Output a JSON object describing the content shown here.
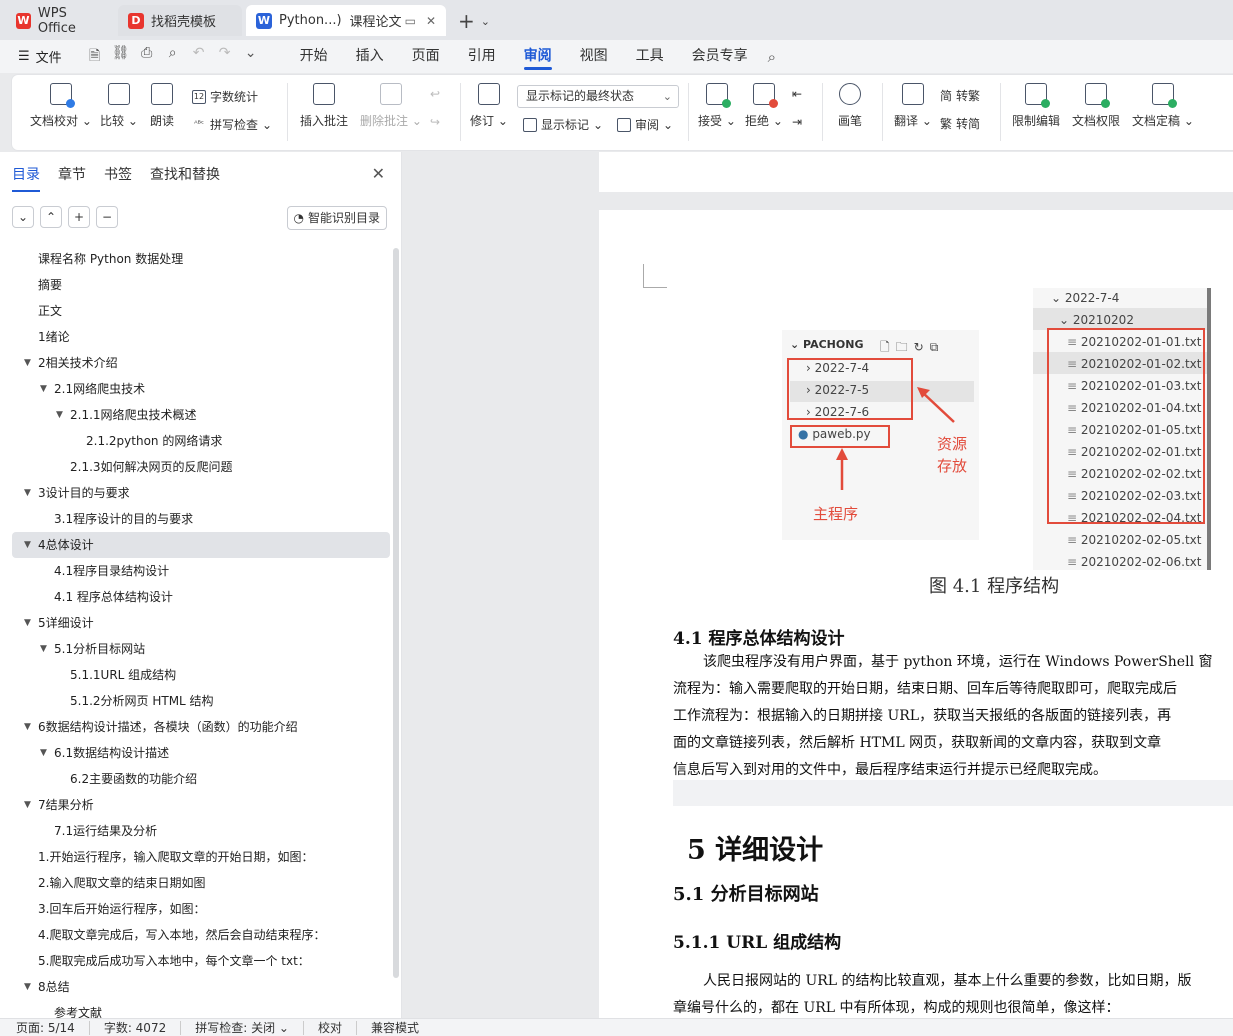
{
  "tabs": {
    "wps": "WPS Office",
    "template": "找稻壳模板",
    "doc": "Python...)",
    "doc_sub": "课程论文"
  },
  "menu": {
    "file": "文件",
    "items": [
      "开始",
      "插入",
      "页面",
      "引用",
      "审阅",
      "视图",
      "工具",
      "会员专享"
    ],
    "active": "审阅"
  },
  "ribbon": {
    "doc_check": "文档校对",
    "compare": "比较",
    "read_aloud": "朗读",
    "word_count": "字数统计",
    "spell_check": "拼写检查",
    "insert_comment": "插入批注",
    "delete_comment": "删除批注",
    "revise": "修订",
    "markup_state": "显示标记的最终状态",
    "show_markup": "显示标记",
    "review": "审阅",
    "accept": "接受",
    "reject": "拒绝",
    "pen": "画笔",
    "translate": "翻译",
    "to_traditional": "转繁",
    "to_simplified": "转简",
    "restrict_edit": "限制编辑",
    "doc_permission": "文档权限",
    "finalize": "文档定稿"
  },
  "nav": {
    "tabs": [
      "目录",
      "章节",
      "书签",
      "查找和替换"
    ],
    "smart_toc": "智能识别目录",
    "toc": [
      {
        "text": "课程名称   Python 数据处理",
        "level": 0,
        "caret": ""
      },
      {
        "text": "摘要",
        "level": 0,
        "caret": ""
      },
      {
        "text": "正文",
        "level": 0,
        "caret": ""
      },
      {
        "text": "1绪论",
        "level": 0,
        "caret": ""
      },
      {
        "text": "2相关技术介绍",
        "level": 0,
        "caret": "down"
      },
      {
        "text": "2.1网络爬虫技术",
        "level": 1,
        "caret": "down"
      },
      {
        "text": "2.1.1网络爬虫技术概述",
        "level": 2,
        "caret": "down"
      },
      {
        "text": "2.1.2python 的网络请求",
        "level": 3,
        "caret": ""
      },
      {
        "text": "2.1.3如何解决网页的反爬问题",
        "level": 2,
        "caret": ""
      },
      {
        "text": "3设计目的与要求",
        "level": 0,
        "caret": "down"
      },
      {
        "text": "3.1程序设计的目的与要求",
        "level": 1,
        "caret": ""
      },
      {
        "text": "4总体设计",
        "level": 0,
        "caret": "down",
        "selected": true
      },
      {
        "text": "4.1程序目录结构设计",
        "level": 1,
        "caret": ""
      },
      {
        "text": "4.1 程序总体结构设计",
        "level": 1,
        "caret": ""
      },
      {
        "text": "5详细设计",
        "level": 0,
        "caret": "down"
      },
      {
        "text": "5.1分析目标网站",
        "level": 1,
        "caret": "down"
      },
      {
        "text": "5.1.1URL 组成结构",
        "level": 2,
        "caret": ""
      },
      {
        "text": "5.1.2分析网页 HTML 结构",
        "level": 2,
        "caret": ""
      },
      {
        "text": "6数据结构设计描述，各模块（函数）的功能介绍",
        "level": 0,
        "caret": "down"
      },
      {
        "text": "6.1数据结构设计描述",
        "level": 1,
        "caret": "down"
      },
      {
        "text": "6.2主要函数的功能介绍",
        "level": 2,
        "caret": ""
      },
      {
        "text": "7结果分析",
        "level": 0,
        "caret": "down"
      },
      {
        "text": "7.1运行结果及分析",
        "level": 1,
        "caret": ""
      },
      {
        "text": "1.开始运行程序，输入爬取文章的开始日期，如图：",
        "level": 0,
        "caret": ""
      },
      {
        "text": "2.输入爬取文章的结束日期如图",
        "level": 0,
        "caret": ""
      },
      {
        "text": "3.回车后开始运行程序，如图：",
        "level": 0,
        "caret": ""
      },
      {
        "text": "4.爬取文章完成后，写入本地，然后会自动结束程序：",
        "level": 0,
        "caret": ""
      },
      {
        "text": "5.爬取完成后成功写入本地中，每个文章一个 txt：",
        "level": 0,
        "caret": ""
      },
      {
        "text": "8总结",
        "level": 0,
        "caret": "down"
      },
      {
        "text": "参考文献",
        "level": 1,
        "caret": ""
      }
    ]
  },
  "document": {
    "fig_left": {
      "header": "PACHONG",
      "folders": [
        "2022-7-4",
        "2022-7-5",
        "2022-7-6"
      ],
      "file": "paweb.py",
      "label_resource": "资源\n存放",
      "label_resource_1": "资源",
      "label_resource_2": "存放",
      "label_main": "主程序"
    },
    "fig_right": {
      "folder": "2022-7-4",
      "subfolder": "20210202",
      "files": [
        "20210202-01-01.txt",
        "20210202-01-02.txt",
        "20210202-01-03.txt",
        "20210202-01-04.txt",
        "20210202-01-05.txt",
        "20210202-02-01.txt",
        "20210202-02-02.txt",
        "20210202-02-03.txt",
        "20210202-02-04.txt",
        "20210202-02-05.txt",
        "20210202-02-06.txt"
      ]
    },
    "caption": "图 4.1 程序结构",
    "heading_41": "4.1 程序总体结构设计",
    "para1": [
      "该爬虫程序没有用户界面，基于 python 环境，运行在 Windows PowerShell 窗",
      "流程为：输入需要爬取的开始日期，结束日期、回车后等待爬取即可，爬取完成后",
      "工作流程为：根据输入的日期拼接 URL，获取当天报纸的各版面的链接列表，再",
      "面的文章链接列表，然后解析 HTML 网页，获取新闻的文章内容，获取到文章",
      "信息后写入到对用的文件中，最后程序结束运行并提示已经爬取完成。"
    ],
    "heading_5": "5 详细设计",
    "heading_51": "5.1 分析目标网站",
    "heading_511": "5.1.1 URL 组成结构",
    "para2": [
      "人民日报网站的 URL 的结构比较直观，基本上什么重要的参数，比如日期，版",
      "章编号什么的，都在 URL 中有所体现，构成的规则也很简单，像这样："
    ]
  },
  "status": {
    "page": "页面: 5/14",
    "words": "字数: 4072",
    "spell": "拼写检查: 关闭",
    "proof": "校对",
    "compat": "兼容模式"
  },
  "colors": {
    "accent": "#1f5ad6",
    "annotation_red": "#e24b3b",
    "wps_red": "#e8352e"
  }
}
